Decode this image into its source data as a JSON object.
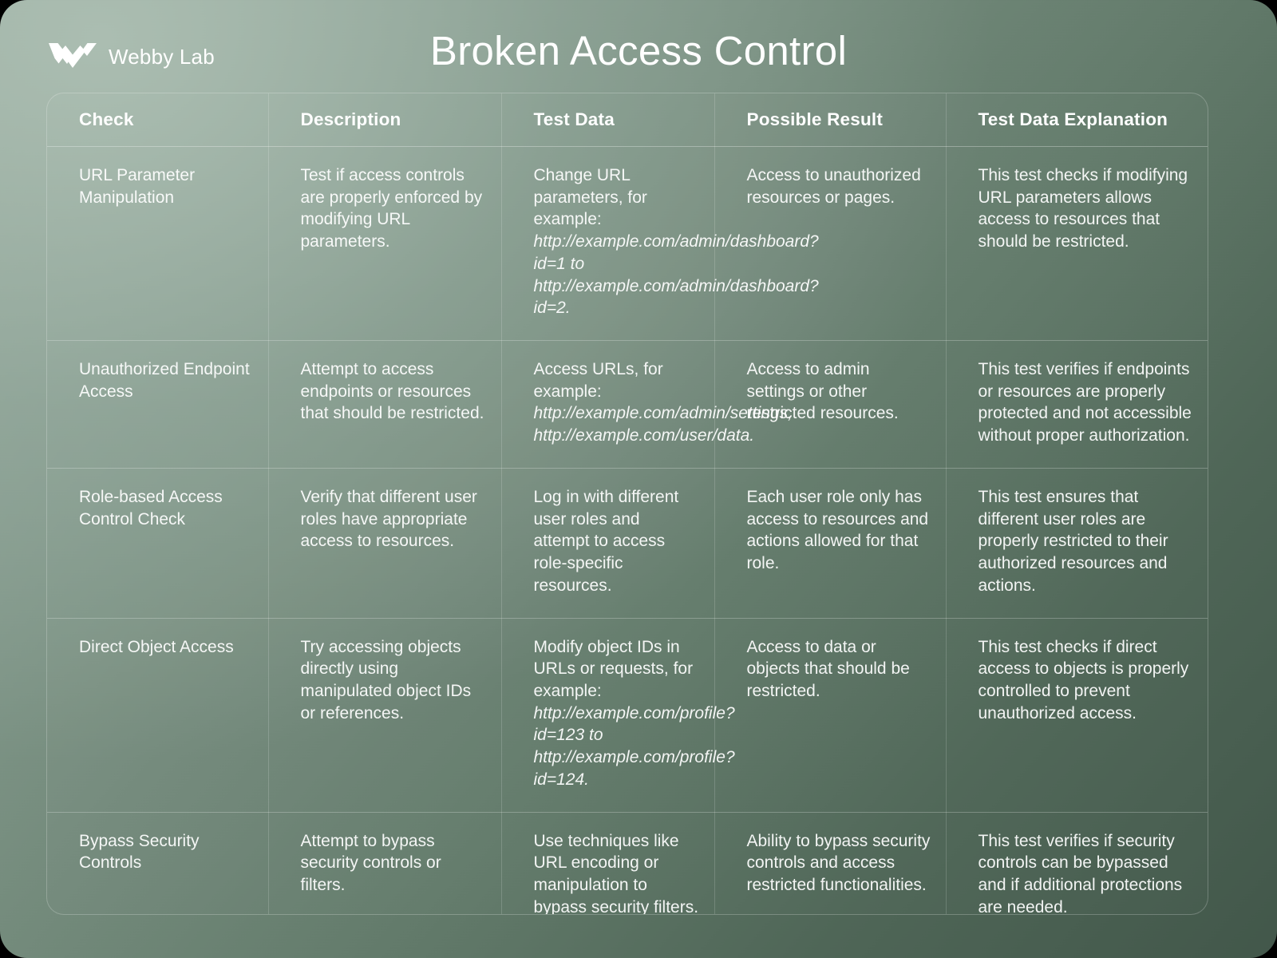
{
  "brand": {
    "name": "Webby Lab",
    "logo_icon": "webbylab-chevron-logo"
  },
  "header": {
    "title": "Broken Access Control"
  },
  "colors": {
    "background_light": "#9fb3a6",
    "background_dark": "#42574a",
    "text": "#ffffff",
    "divider": "rgba(255,255,255,0.2)"
  },
  "table": {
    "columns": [
      {
        "key": "check",
        "label": "Check"
      },
      {
        "key": "description",
        "label": "Description"
      },
      {
        "key": "test_data",
        "label": "Test Data"
      },
      {
        "key": "possible_result",
        "label": "Possible Result"
      },
      {
        "key": "test_data_explanation",
        "label": "Test Data Explanation"
      }
    ],
    "rows": [
      {
        "check": "URL Parameter Manipulation",
        "description": "Test if access controls are properly enforced by modifying URL parameters.",
        "test_data_lead": "Change URL parameters, for example: ",
        "test_data_url": "http://example.com/admin/dashboard?id=1 to http://example.com/admin/dashboard?id=2.",
        "possible_result": "Access to unauthorized resources or pages.",
        "test_data_explanation": "This test checks if modifying URL parameters allows access to resources that should be restricted."
      },
      {
        "check": "Unauthorized Endpoint Access",
        "description": "Attempt to access endpoints or resources that should be restricted.",
        "test_data_lead": "Access URLs, for example: ",
        "test_data_url": "http://example.com/admin/settings, http://example.com/user/data.",
        "possible_result": "Access to admin settings or other restricted resources.",
        "test_data_explanation": "This test verifies if endpoints or resources are properly protected and not accessible without proper authorization."
      },
      {
        "check": "Role-based Access Control Check",
        "description": "Verify that different user roles have appropriate access to resources.",
        "test_data_lead": "Log in with different user roles and attempt to access role-specific resources.",
        "test_data_url": "",
        "possible_result": "Each user role only has access to resources and actions allowed for that role.",
        "test_data_explanation": "This test ensures that different user roles are properly restricted to their authorized resources and actions."
      },
      {
        "check": "Direct Object Access",
        "description": "Try accessing objects directly using manipulated object IDs or references.",
        "test_data_lead": "Modify object IDs in URLs or requests, for example: ",
        "test_data_url": "http://example.com/profile?id=123 to http://example.com/profile?id=124.",
        "possible_result": "Access to data or objects that should be restricted.",
        "test_data_explanation": "This test checks if direct access to objects is properly controlled to prevent unauthorized access."
      },
      {
        "check": "Bypass Security Controls",
        "description": "Attempt to bypass security controls or filters.",
        "test_data_lead": "Use techniques like URL encoding or manipulation to bypass security filters.",
        "test_data_url": "",
        "possible_result": "Ability to bypass security controls and access restricted functionalities.",
        "test_data_explanation": "This test verifies if security controls can be bypassed and if additional protections are needed."
      }
    ]
  }
}
